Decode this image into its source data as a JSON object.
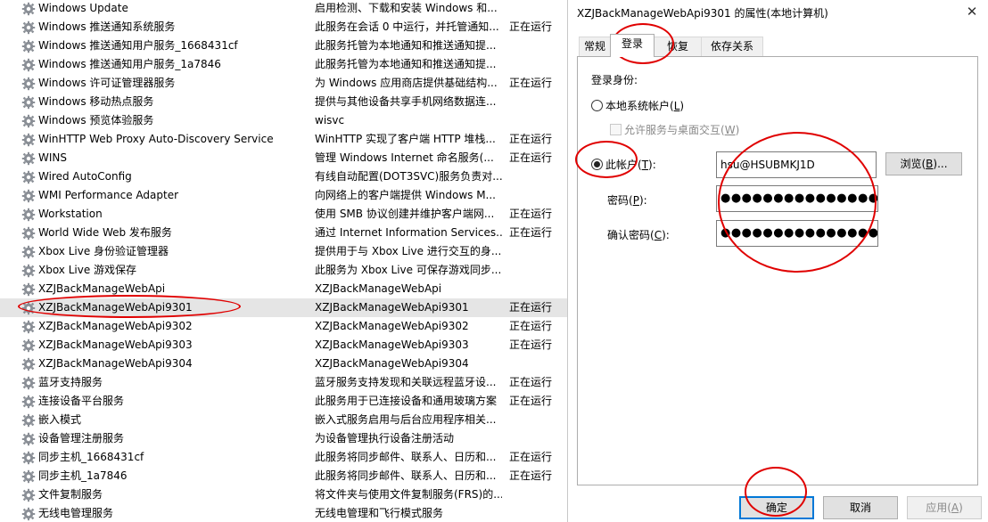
{
  "services": [
    {
      "name": "Windows Update",
      "desc": "启用检测、下载和安装 Windows 和...",
      "status": ""
    },
    {
      "name": "Windows 推送通知系统服务",
      "desc": "此服务在会话 0 中运行，并托管通知...",
      "status": "正在运行"
    },
    {
      "name": "Windows 推送通知用户服务_1668431cf",
      "desc": "此服务托管为本地通知和推送通知提...",
      "status": ""
    },
    {
      "name": "Windows 推送通知用户服务_1a7846",
      "desc": "此服务托管为本地通知和推送通知提...",
      "status": ""
    },
    {
      "name": "Windows 许可证管理器服务",
      "desc": "为 Windows 应用商店提供基础结构...",
      "status": "正在运行"
    },
    {
      "name": "Windows 移动热点服务",
      "desc": "提供与其他设备共享手机网络数据连...",
      "status": ""
    },
    {
      "name": "Windows 预览体验服务",
      "desc": "wisvc",
      "status": ""
    },
    {
      "name": "WinHTTP Web Proxy Auto-Discovery Service",
      "desc": "WinHTTP 实现了客户端 HTTP 堆栈...",
      "status": "正在运行"
    },
    {
      "name": "WINS",
      "desc": "管理 Windows Internet 命名服务(...",
      "status": "正在运行"
    },
    {
      "name": "Wired AutoConfig",
      "desc": "有线自动配置(DOT3SVC)服务负责对...",
      "status": ""
    },
    {
      "name": "WMI Performance Adapter",
      "desc": "向网络上的客户端提供 Windows M...",
      "status": ""
    },
    {
      "name": "Workstation",
      "desc": "使用 SMB 协议创建并维护客户端网...",
      "status": "正在运行"
    },
    {
      "name": "World Wide Web 发布服务",
      "desc": "通过 Internet Information Services...",
      "status": "正在运行"
    },
    {
      "name": "Xbox Live 身份验证管理器",
      "desc": "提供用于与 Xbox Live 进行交互的身...",
      "status": ""
    },
    {
      "name": "Xbox Live 游戏保存",
      "desc": "此服务为 Xbox Live 可保存游戏同步...",
      "status": ""
    },
    {
      "name": "XZJBackManageWebApi",
      "desc": "XZJBackManageWebApi",
      "status": ""
    },
    {
      "name": "XZJBackManageWebApi9301",
      "desc": "XZJBackManageWebApi9301",
      "status": "正在运行"
    },
    {
      "name": "XZJBackManageWebApi9302",
      "desc": "XZJBackManageWebApi9302",
      "status": "正在运行"
    },
    {
      "name": "XZJBackManageWebApi9303",
      "desc": "XZJBackManageWebApi9303",
      "status": "正在运行"
    },
    {
      "name": "XZJBackManageWebApi9304",
      "desc": "XZJBackManageWebApi9304",
      "status": ""
    },
    {
      "name": "蓝牙支持服务",
      "desc": "蓝牙服务支持发现和关联远程蓝牙设...",
      "status": "正在运行"
    },
    {
      "name": "连接设备平台服务",
      "desc": "此服务用于已连接设备和通用玻璃方案",
      "status": "正在运行"
    },
    {
      "name": "嵌入模式",
      "desc": "嵌入式服务启用与后台应用程序相关...",
      "status": ""
    },
    {
      "name": "设备管理注册服务",
      "desc": "为设备管理执行设备注册活动",
      "status": ""
    },
    {
      "name": "同步主机_1668431cf",
      "desc": "此服务将同步邮件、联系人、日历和...",
      "status": "正在运行"
    },
    {
      "name": "同步主机_1a7846",
      "desc": "此服务将同步邮件、联系人、日历和...",
      "status": "正在运行"
    },
    {
      "name": "文件复制服务",
      "desc": "将文件夹与使用文件复制服务(FRS)的...",
      "status": ""
    },
    {
      "name": "无线电管理服务",
      "desc": "无线电管理和飞行模式服务",
      "status": ""
    }
  ],
  "selected_index": 16,
  "dialog": {
    "title": "XZJBackManageWebApi9301 的属性(本地计算机)",
    "close": "✕",
    "tabs": [
      "常规",
      "登录",
      "恢复",
      "依存关系"
    ],
    "active_tab": 1,
    "logon_as_label": "登录身份:",
    "local_system_label": "本地系统帐户(",
    "local_system_key": "L",
    "interact_label": "允许服务与桌面交互(",
    "interact_key": "W",
    "this_account_label": "此帐户(",
    "this_account_key": "T",
    "account_value": "hsu@HSUBMKJ1D",
    "browse_label": "浏览(",
    "browse_key": "B",
    "password_label": "密码(",
    "password_key": "P",
    "password_value": "●●●●●●●●●●●●●●●",
    "confirm_label": "确认密码(",
    "confirm_key": "C",
    "confirm_value": "●●●●●●●●●●●●●●●",
    "ok_label": "确定",
    "cancel_label": "取消",
    "apply_label": "应用(",
    "apply_key": "A"
  },
  "colors": {
    "annotation": "#e00000",
    "selection": "#e5e5e5",
    "default_button_border": "#0078d7"
  }
}
